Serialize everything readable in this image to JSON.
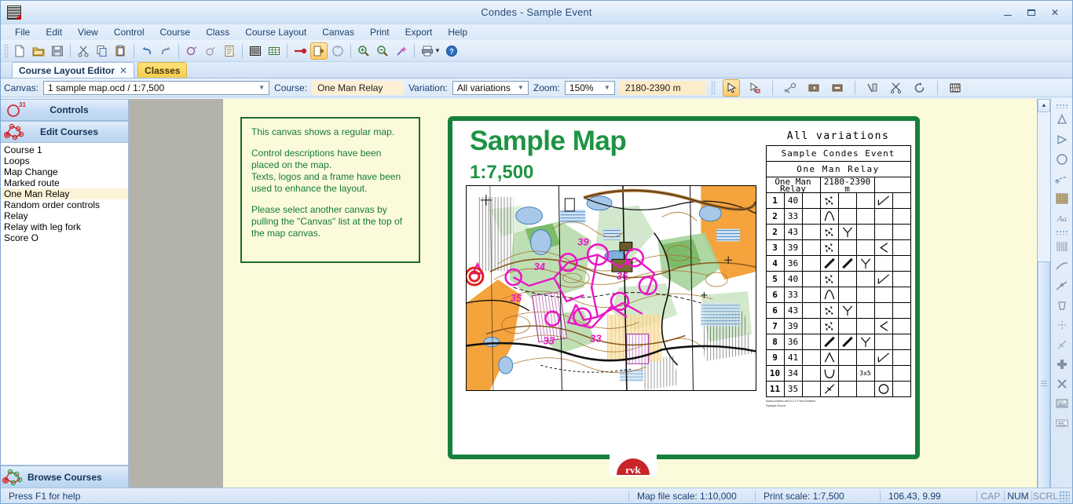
{
  "window": {
    "title": "Condes - Sample Event",
    "minimize": "–",
    "maximize": "▢",
    "close": "✕"
  },
  "menu": {
    "items": [
      {
        "label": "File"
      },
      {
        "label": "Edit"
      },
      {
        "label": "View"
      },
      {
        "label": "Control"
      },
      {
        "label": "Course"
      },
      {
        "label": "Class"
      },
      {
        "label": "Course Layout"
      },
      {
        "label": "Canvas"
      },
      {
        "label": "Print"
      },
      {
        "label": "Export"
      },
      {
        "label": "Help"
      }
    ]
  },
  "toolbar": {
    "buttons": [
      {
        "name": "new-file-icon",
        "title": "New"
      },
      {
        "name": "open-folder-icon",
        "title": "Open"
      },
      {
        "name": "save-disk-icon",
        "title": "Save"
      },
      {
        "name": "cut-scissors-icon",
        "title": "Cut"
      },
      {
        "name": "copy-icon",
        "title": "Copy"
      },
      {
        "name": "paste-icon",
        "title": "Paste"
      },
      {
        "name": "undo-arrow-icon",
        "title": "Undo"
      },
      {
        "name": "redo-arrow-icon",
        "title": "Redo"
      },
      {
        "name": "control-add-icon",
        "title": "Add control"
      },
      {
        "name": "control-edit-icon",
        "title": "Edit control"
      },
      {
        "name": "control-list-icon",
        "title": "Control list"
      },
      {
        "name": "table-dense-icon",
        "title": "Control descriptions"
      },
      {
        "name": "table-grid-icon",
        "title": "Grid"
      },
      {
        "name": "start-triangle-icon",
        "title": "Start"
      },
      {
        "name": "course-layout-icon",
        "title": "Course layout editor"
      },
      {
        "name": "class-icon",
        "title": "Classes"
      },
      {
        "name": "zoom-in-icon",
        "title": "Zoom in"
      },
      {
        "name": "zoom-out-icon",
        "title": "Zoom out"
      },
      {
        "name": "magic-wand-icon",
        "title": "Automatic"
      },
      {
        "name": "print-icon",
        "title": "Print"
      },
      {
        "name": "help-icon",
        "title": "Help"
      }
    ]
  },
  "tabs": [
    {
      "label": "Course Layout Editor",
      "close": "✕",
      "active": true
    },
    {
      "label": "Classes",
      "active": false
    }
  ],
  "canvasbar": {
    "canvas_label": "Canvas:",
    "canvas_value": "1 sample map.ocd   / 1:7,500",
    "course_label": "Course:",
    "course_value": "One Man Relay",
    "variation_label": "Variation:",
    "variation_value": "All variations",
    "zoom_label": "Zoom:",
    "zoom_value": "150%",
    "length_value": "2180-2390 m",
    "tools": [
      {
        "name": "select-pointer-icon",
        "active": true
      },
      {
        "name": "select-add-pointer-icon",
        "active": false
      },
      {
        "name": "cut-leg-icon",
        "active": false
      },
      {
        "name": "move-control-right-icon",
        "active": false
      },
      {
        "name": "move-control-left-icon",
        "active": false
      },
      {
        "name": "bend-leg-icon",
        "active": false
      },
      {
        "name": "trim-legs-icon",
        "active": false
      },
      {
        "name": "rotate-icon",
        "active": false
      },
      {
        "name": "renumber-icon",
        "active": false
      }
    ]
  },
  "sidebar": {
    "controls_header": "Controls",
    "controls_badge": "31",
    "edit_courses_header": "Edit Courses",
    "browse_courses_footer": "Browse Courses",
    "courses": [
      {
        "label": "Course 1",
        "selected": false
      },
      {
        "label": "Loops",
        "selected": false
      },
      {
        "label": "Map Change",
        "selected": false
      },
      {
        "label": "Marked route",
        "selected": false
      },
      {
        "label": "One Man Relay",
        "selected": true
      },
      {
        "label": "Random order controls",
        "selected": false
      },
      {
        "label": "Relay",
        "selected": false
      },
      {
        "label": "Relay with leg fork",
        "selected": false
      },
      {
        "label": "Score O",
        "selected": false
      }
    ]
  },
  "note": {
    "paragraphs": [
      "This canvas shows a regular map.",
      "Control descriptions have been placed on the map.\nTexts, logos and a frame have been used to enhance the layout.",
      "Please select another canvas by pulling the \"Canvas\" list at the top of the map canvas."
    ]
  },
  "sheet": {
    "title": "Sample Map",
    "scale": "1:7,500",
    "all_variations": "All variations",
    "event_name": "Sample Condes Event",
    "course_name": "One Man Relay",
    "leg_label": "One Man Relay",
    "length_label": "2180-2390 m",
    "footer_line1": "www.condes.net  8.3.1  Finn Arildsen",
    "footer_line2": "Sample Event"
  },
  "control_descriptions": {
    "columns": [
      "number",
      "code",
      "which",
      "what",
      "appearance",
      "dimensions",
      "location",
      "other"
    ],
    "rows": [
      {
        "number": "1",
        "code": "40",
        "which": "",
        "what": "boulder-field",
        "appearance": "",
        "dimensions": "",
        "location": "ne-corner",
        "other": ""
      },
      {
        "number": "2",
        "code": "33",
        "which": "",
        "what": "knoll",
        "appearance": "",
        "dimensions": "",
        "location": "",
        "other": ""
      },
      {
        "number": "2",
        "code": "43",
        "which": "",
        "what": "boulder-field",
        "appearance": "junction",
        "dimensions": "",
        "location": "",
        "other": ""
      },
      {
        "number": "3",
        "code": "39",
        "which": "",
        "what": "boulder-field",
        "appearance": "",
        "dimensions": "",
        "location": "west-side",
        "other": ""
      },
      {
        "number": "4",
        "code": "36",
        "which": "",
        "what": "ride",
        "appearance": "ride",
        "dimensions": "junction",
        "location": "",
        "other": ""
      },
      {
        "number": "5",
        "code": "40",
        "which": "",
        "what": "boulder-field",
        "appearance": "",
        "dimensions": "",
        "location": "ne-corner",
        "other": ""
      },
      {
        "number": "6",
        "code": "33",
        "which": "",
        "what": "knoll",
        "appearance": "",
        "dimensions": "",
        "location": "",
        "other": ""
      },
      {
        "number": "6",
        "code": "43",
        "which": "",
        "what": "boulder-field",
        "appearance": "junction",
        "dimensions": "",
        "location": "",
        "other": ""
      },
      {
        "number": "7",
        "code": "39",
        "which": "",
        "what": "boulder-field",
        "appearance": "",
        "dimensions": "",
        "location": "west-side",
        "other": ""
      },
      {
        "number": "8",
        "code": "36",
        "which": "",
        "what": "ride",
        "appearance": "ride",
        "dimensions": "junction",
        "location": "",
        "other": ""
      },
      {
        "number": "9",
        "code": "41",
        "which": "",
        "what": "hill",
        "appearance": "",
        "dimensions": "",
        "location": "ne-corner",
        "other": ""
      },
      {
        "number": "10",
        "code": "34",
        "which": "",
        "what": "depression",
        "appearance": "",
        "dimensions": "3x5",
        "location": "",
        "other": ""
      },
      {
        "number": "11",
        "code": "35",
        "which": "",
        "what": "crossing-point",
        "appearance": "",
        "dimensions": "",
        "location": "circle",
        "other": ""
      }
    ]
  },
  "rightbar": {
    "tools": [
      {
        "name": "start-triangle-marker-icon"
      },
      {
        "name": "finish-triangle-icon"
      },
      {
        "name": "control-circle-icon"
      },
      {
        "name": "marked-route-icon"
      },
      {
        "name": "control-description-table-icon"
      },
      {
        "name": "text-Aa-icon"
      },
      {
        "name": "hatch-pattern-icon"
      },
      {
        "name": "curve-line-icon"
      },
      {
        "name": "bent-line-icon"
      },
      {
        "name": "bucket-fill-icon"
      },
      {
        "name": "crossing-point-icon"
      },
      {
        "name": "crossing-dashed-icon"
      },
      {
        "name": "plus-cross-icon"
      },
      {
        "name": "x-cross-icon"
      },
      {
        "name": "image-icon"
      },
      {
        "name": "legend-icon"
      }
    ]
  },
  "statusbar": {
    "hint": "Press F1 for help",
    "map_file_scale": "Map file scale: 1:10,000",
    "print_scale": "Print scale: 1:7,500",
    "coordinates": "106.43, 9.99",
    "cap": "CAP",
    "num": "NUM",
    "scrl": "SCRL"
  },
  "colors": {
    "accent_green": "#17803c",
    "title_green": "#1e9443",
    "highlight_yellow": "#fdf3d6",
    "canvas_bg": "#fbfbdc",
    "chrome_blue": "#cfe0f4"
  }
}
